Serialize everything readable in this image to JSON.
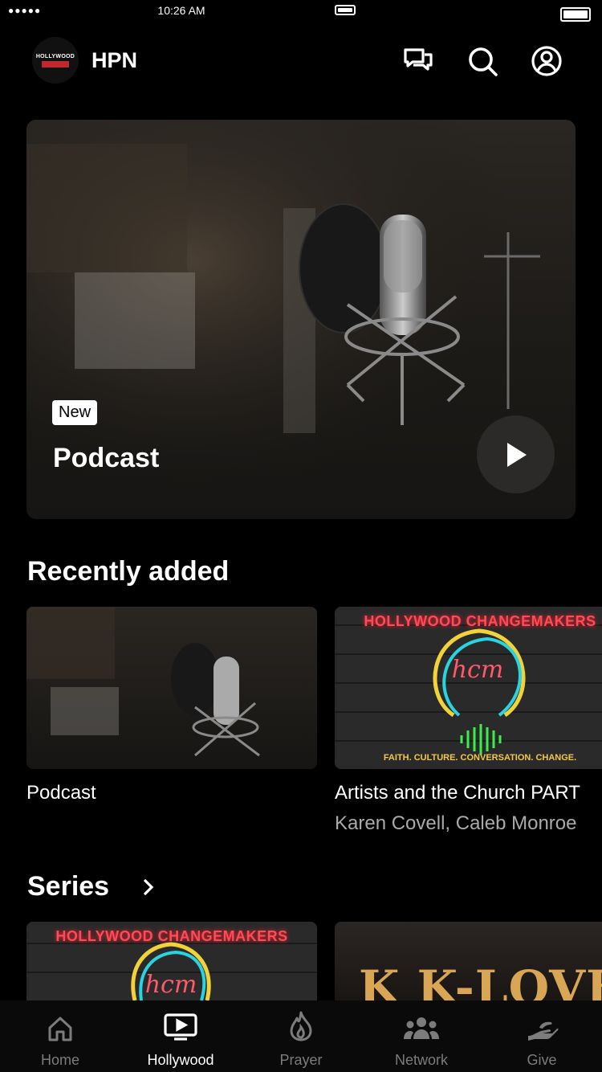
{
  "status_bar": {
    "signal": "●●●●●",
    "time": "10:26 AM"
  },
  "header": {
    "title": "HPN",
    "logo_text": "HOLLYWOOD"
  },
  "hero": {
    "badge": "New",
    "title": "Podcast"
  },
  "recently_added": {
    "title": "Recently added",
    "items": [
      {
        "title": "Podcast",
        "subtitle": ""
      },
      {
        "title": "Artists and the Church PART",
        "subtitle": "Karen Covell, Caleb Monroe"
      }
    ]
  },
  "series": {
    "title": "Series",
    "items": [
      {
        "banner": "HOLLYWOOD CHANGEMAKERS",
        "logo": "hcm"
      },
      {
        "banner": "K K-LOVE"
      }
    ]
  },
  "hcm_card": {
    "banner": "HOLLYWOOD CHANGEMAKERS",
    "logo": "hcm",
    "tagline": "FAITH. CULTURE. CONVERSATION. CHANGE."
  },
  "tabs": [
    {
      "label": "Home",
      "icon": "home-icon",
      "active": false
    },
    {
      "label": "Hollywood",
      "icon": "tv-icon",
      "active": true
    },
    {
      "label": "Prayer",
      "icon": "flame-icon",
      "active": false
    },
    {
      "label": "Network",
      "icon": "people-icon",
      "active": false
    },
    {
      "label": "Give",
      "icon": "give-icon",
      "active": false
    }
  ]
}
